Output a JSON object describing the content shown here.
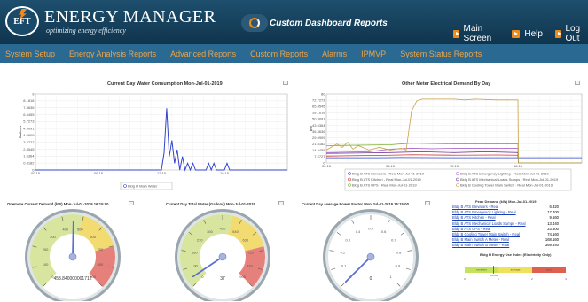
{
  "header": {
    "logo_text": "EFT",
    "brand_title": "ENERGY MANAGER",
    "brand_subtitle": "optimizing energy efficiency",
    "dashboard_title": "Custom Dashboard Reports",
    "main_screen": "Main Screen",
    "help": "Help",
    "logout": "Log Out"
  },
  "menu": [
    "System Setup",
    "Energy Analysis Reports",
    "Advanced Reports",
    "Custom Reports",
    "Alarms",
    "IPMVP",
    "System Status Reports"
  ],
  "charts": {
    "water": {
      "title": "Current Day Water Consumption Mon-Jul-01-2019",
      "ylabel": "Gallons",
      "yticks": [
        "9",
        "8.1818",
        "7.3636",
        "6.5455",
        "5.7273",
        "4.9091",
        "4.0909",
        "3.2727",
        "2.4545",
        "1.6364",
        "0.8182",
        "0"
      ],
      "xticks": [
        "00:15",
        "06:15",
        "12:15",
        "18:15"
      ],
      "legend": "Bldg H Main Water"
    },
    "electric": {
      "title": "Other Meter Electrical Demand By Day",
      "ylabel": "kW",
      "yticks": [
        "80",
        "72.7273",
        "65.4545",
        "58.1818",
        "50.9091",
        "43.6364",
        "36.3636",
        "29.0909",
        "21.8182",
        "14.5455",
        "7.2727",
        "0"
      ],
      "xticks": [
        "00:15",
        "06:15",
        "12:15",
        "18:15"
      ],
      "legend": [
        "Bldg B ATS Elevators - Real Mon-Jul-01-2019",
        "Bldg B ATS Emergency Lighting - Real Mon-Jul-01-2019",
        "Bldg B ATS Kitchen - Real Mon-Jul-01-2019",
        "Bldg B ATS Mechanical Loads Sumps - Real Mon-Jul-01-2019",
        "Bldg B ATS UPS - Real Mon-Jul-01-2019",
        "Bldg B Cooling Tower Main Switch - Real Mon-Jul-01-2019"
      ]
    }
  },
  "gauges": {
    "demand": {
      "title": "Onemore Current Demand (kW) Mon-Jul-01-2019 16:15:00",
      "ticks": [
        "0",
        "100",
        "200",
        "300",
        "400",
        "500",
        "600",
        "700",
        "800",
        "900"
      ],
      "value": 453.840000001712,
      "value_label": "453.840000001712"
    },
    "water_total": {
      "title": "Current Day Total Water (Gallons) Mon-Jul-01-2019",
      "ticks": [
        "0",
        "90",
        "180",
        "270",
        "360",
        "450",
        "540",
        "630",
        "720",
        "810",
        "900"
      ],
      "value": 37,
      "value_label": "37"
    },
    "power_factor": {
      "title": "Current Day Average Power Factor Mon-Jul-01-2019 16:15:00",
      "ticks": [
        "0",
        "0.1",
        "0.2",
        "0.3",
        "0.4",
        "0.5",
        "0.6",
        "0.7",
        "0.8",
        "0.9",
        "1"
      ],
      "value": 0,
      "value_label": "0"
    }
  },
  "peak": {
    "title": "Peak Demand (kW) Mon-Jul-01-2019",
    "rows": [
      {
        "label": "Bldg B ATS Elevators - Real",
        "value": "6.320"
      },
      {
        "label": "Bldg B ATS Emergency Lighting - Real",
        "value": "17.400"
      },
      {
        "label": "Bldg B ATS Kitchen - Real",
        "value": "9.560"
      },
      {
        "label": "Bldg B ATS Mechanical Loads Sumps - Real",
        "value": "13.440"
      },
      {
        "label": "Bldg B ATS UPS - Real",
        "value": "23.600"
      },
      {
        "label": "Bldg B Cooling Tower Main Switch - Real",
        "value": "74.160"
      },
      {
        "label": "Bldg B Main Switch A Meter - Real",
        "value": "168.160"
      },
      {
        "label": "Bldg B Main Switch B Meter - Real",
        "value": "369.640"
      }
    ]
  },
  "eui": {
    "title": "Bldg H Energy Use Index (Electricity Only)",
    "labels": [
      "excellent",
      "average",
      "poor"
    ],
    "ticks": [
      "0",
      "1",
      "2",
      "3"
    ],
    "marker_label": "0.8585"
  },
  "colors": {
    "header": "#0f344d",
    "menubar": "#2a6a92",
    "menu_text": "#f2a341",
    "accent": "#f28a1a"
  }
}
